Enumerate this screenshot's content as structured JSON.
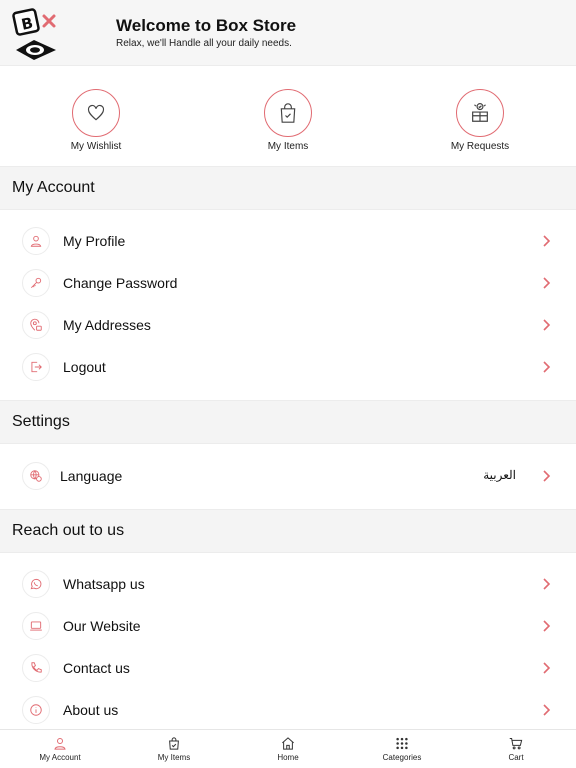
{
  "header": {
    "logo_text": "BOX",
    "title": "Welcome to Box Store",
    "subtitle": "Relax, we'll Handle all your daily needs."
  },
  "shortcuts": [
    {
      "label": "My Wishlist",
      "icon": "heart-icon"
    },
    {
      "label": "My Items",
      "icon": "shopping-bag-icon"
    },
    {
      "label": "My Requests",
      "icon": "requests-icon"
    }
  ],
  "sections": {
    "account": {
      "title": "My Account",
      "items": [
        {
          "label": "My Profile",
          "icon": "user-icon"
        },
        {
          "label": "Change Password",
          "icon": "key-icon"
        },
        {
          "label": "My Addresses",
          "icon": "location-icon"
        },
        {
          "label": "Logout",
          "icon": "logout-icon"
        }
      ]
    },
    "settings": {
      "title": "Settings",
      "items": [
        {
          "label": "Language",
          "value": "العربية",
          "icon": "globe-icon"
        }
      ]
    },
    "reach": {
      "title": "Reach out to us",
      "items": [
        {
          "label": "Whatsapp us",
          "icon": "whatsapp-icon"
        },
        {
          "label": "Our Website",
          "icon": "laptop-icon"
        },
        {
          "label": "Contact us",
          "icon": "phone-icon"
        },
        {
          "label": "About us",
          "icon": "info-icon"
        }
      ]
    }
  },
  "tabbar": [
    {
      "label": "My Account",
      "icon": "user-icon",
      "active": true
    },
    {
      "label": "My Items",
      "icon": "bag-icon"
    },
    {
      "label": "Home",
      "icon": "home-icon"
    },
    {
      "label": "Categories",
      "icon": "grid-icon"
    },
    {
      "label": "Cart",
      "icon": "cart-icon"
    }
  ],
  "colors": {
    "accent": "#e16b72",
    "section_bg": "#f4f4f4",
    "text": "#111111"
  }
}
